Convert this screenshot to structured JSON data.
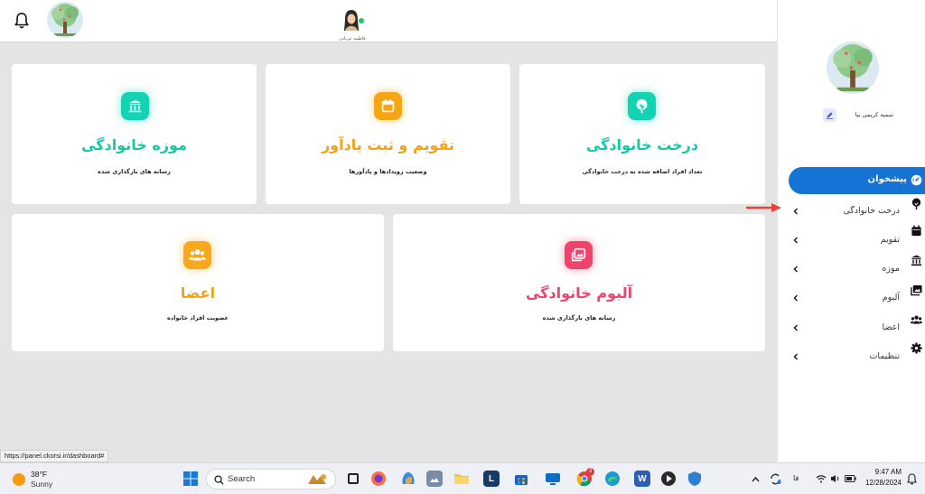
{
  "header": {
    "user_name": "فاطمه عربانی"
  },
  "cards": {
    "museum": {
      "title": "موزه خانوادگی",
      "subtitle": "رسانه های بارگذاری شده",
      "icon": "museum-icon",
      "color": "#14d3b3"
    },
    "calendar": {
      "title": "تقویم و ثبت یادآور",
      "subtitle": "وضعیت رویدادها و یادآورها",
      "icon": "calendar-icon",
      "color": "#f6a514"
    },
    "tree": {
      "title": "درخت خانوادگی",
      "subtitle": "تعداد افراد اضافه شده به درخت خانوادگی",
      "icon": "tree-icon",
      "color": "#14d3b3"
    },
    "members": {
      "title": "اعضا",
      "subtitle": "عضویت افراد خانواده",
      "icon": "users-icon",
      "color": "#f8a81b"
    },
    "album": {
      "title": "آلبوم خانوادگی",
      "subtitle": "رسانه های بارگذاری شده",
      "icon": "images-icon",
      "color": "#f0436b"
    }
  },
  "sidebar": {
    "profile_name": "سمیه کریمی نیا",
    "active_item": "پیشخوان",
    "items": [
      {
        "label": "درخت خانوادگی",
        "icon": "tree-icon"
      },
      {
        "label": "تقویم",
        "icon": "calendar-icon"
      },
      {
        "label": "موزه",
        "icon": "museum-icon"
      },
      {
        "label": "آلبوم",
        "icon": "images-icon"
      },
      {
        "label": "اعضا",
        "icon": "users-icon"
      },
      {
        "label": "تنظیمات",
        "icon": "gear-icon"
      }
    ]
  },
  "status_url": "https://panel.ckorsi.ir/dashboard#",
  "taskbar": {
    "weather_temp": "38°F",
    "weather_condition": "Sunny",
    "search_label": "Search",
    "language": "فا",
    "time": "9:47 AM",
    "date": "12/28/2024",
    "notification_badge": "3"
  },
  "colors": {
    "primary": "#1473d4",
    "teal": "#14d3b3",
    "orange": "#f6a514",
    "pink": "#f0436b",
    "annotation_arrow": "#e8423a"
  }
}
